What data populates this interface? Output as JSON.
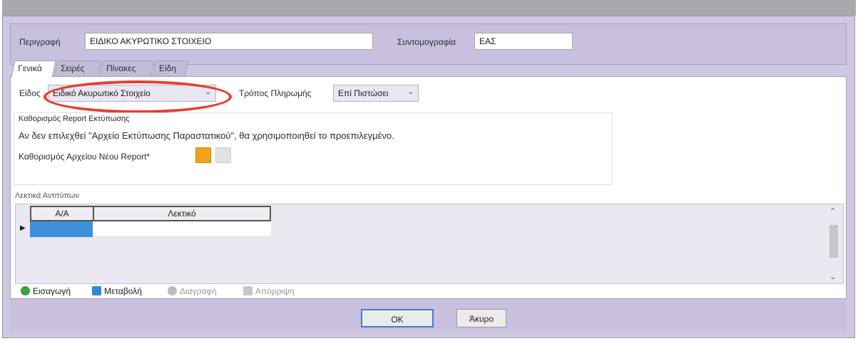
{
  "header": {
    "description_label": "Περιγραφή",
    "description_value": "ΕΙΔΙΚΟ ΑΚΥΡΩΤΙΚΟ ΣΤΟΙΧΕΙΟ",
    "abbr_label": "Συντομογραφία",
    "abbr_value": "ΕΑΣ"
  },
  "tabs": [
    {
      "label": "Γενικά"
    },
    {
      "label": "Σειρές"
    },
    {
      "label": "Πίνακες"
    },
    {
      "label": "Είδη"
    }
  ],
  "general": {
    "type_label": "Είδος",
    "type_value": "Ειδικό Ακυρωτικό Στοιχείο",
    "payment_label": "Τρόπος Πληρωμής",
    "payment_value": "Επί Πιστώσει",
    "report_group_label": "Καθορισμός Report Εκτύπωσης",
    "report_info": "Αν δεν επιλεχθεί \"Αρχείο Εκτύπωσης Παραστατικού\", θα χρησιμοποιηθεί το προεπιλεγμένο.",
    "new_report_label": "Καθορισμός Αρχείου Νέου Report*"
  },
  "copies": {
    "group_label": "Λεκτικά Αντιτύπων",
    "columns": [
      "Α/Α",
      "Λεκτικό"
    ]
  },
  "toolbar": {
    "insert": "Εισαγωγή",
    "edit": "Μεταβολή",
    "delete": "Διαγραφή",
    "cancel": "Απόρριψη"
  },
  "footer": {
    "ok": "OK",
    "cancel": "Άκυρο"
  },
  "colors": {
    "shell": "#cfc8e0",
    "highlight_oval": "#e2412e",
    "selected_cell": "#3d8fdc"
  }
}
